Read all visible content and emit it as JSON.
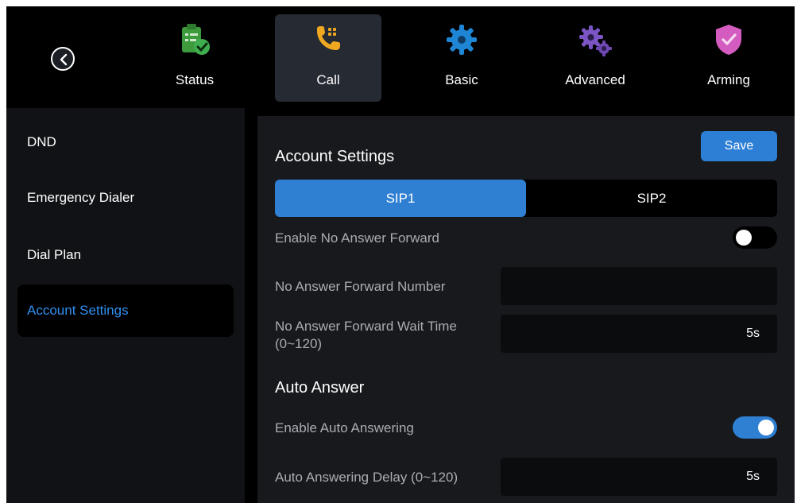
{
  "tabs": [
    {
      "label": "Status",
      "icon": "clipboard-check-icon",
      "active": false
    },
    {
      "label": "Call",
      "icon": "phone-dialpad-icon",
      "active": true
    },
    {
      "label": "Basic",
      "icon": "gear-icon",
      "active": false
    },
    {
      "label": "Advanced",
      "icon": "gears-icon",
      "active": false
    },
    {
      "label": "Arming",
      "icon": "shield-check-icon",
      "active": false
    }
  ],
  "sidebar": {
    "items": [
      {
        "label": "DND",
        "active": false
      },
      {
        "label": "Emergency Dialer",
        "active": false
      },
      {
        "label": "Dial Plan",
        "active": false
      },
      {
        "label": "Account Settings",
        "active": true
      }
    ]
  },
  "main": {
    "title": "Account Settings",
    "save_label": "Save",
    "segments": [
      {
        "label": "SIP1",
        "active": true
      },
      {
        "label": "SIP2",
        "active": false
      }
    ],
    "enable_no_answer_forward": {
      "label": "Enable No Answer Forward",
      "on": false
    },
    "no_answer_forward_number": {
      "label": "No Answer Forward Number",
      "value": ""
    },
    "no_answer_forward_wait_time": {
      "label": "No Answer Forward Wait Time (0~120)",
      "value": "5s"
    },
    "auto_answer_title": "Auto Answer",
    "enable_auto_answering": {
      "label": "Enable Auto Answering",
      "on": true
    },
    "auto_answering_delay": {
      "label": "Auto Answering Delay (0~120)",
      "value": "5s"
    }
  },
  "colors": {
    "accent": "#2f7fd2",
    "active_text": "#2f8ff0",
    "background": "#000000",
    "panel": "#17191d",
    "sidebar": "#101215"
  }
}
